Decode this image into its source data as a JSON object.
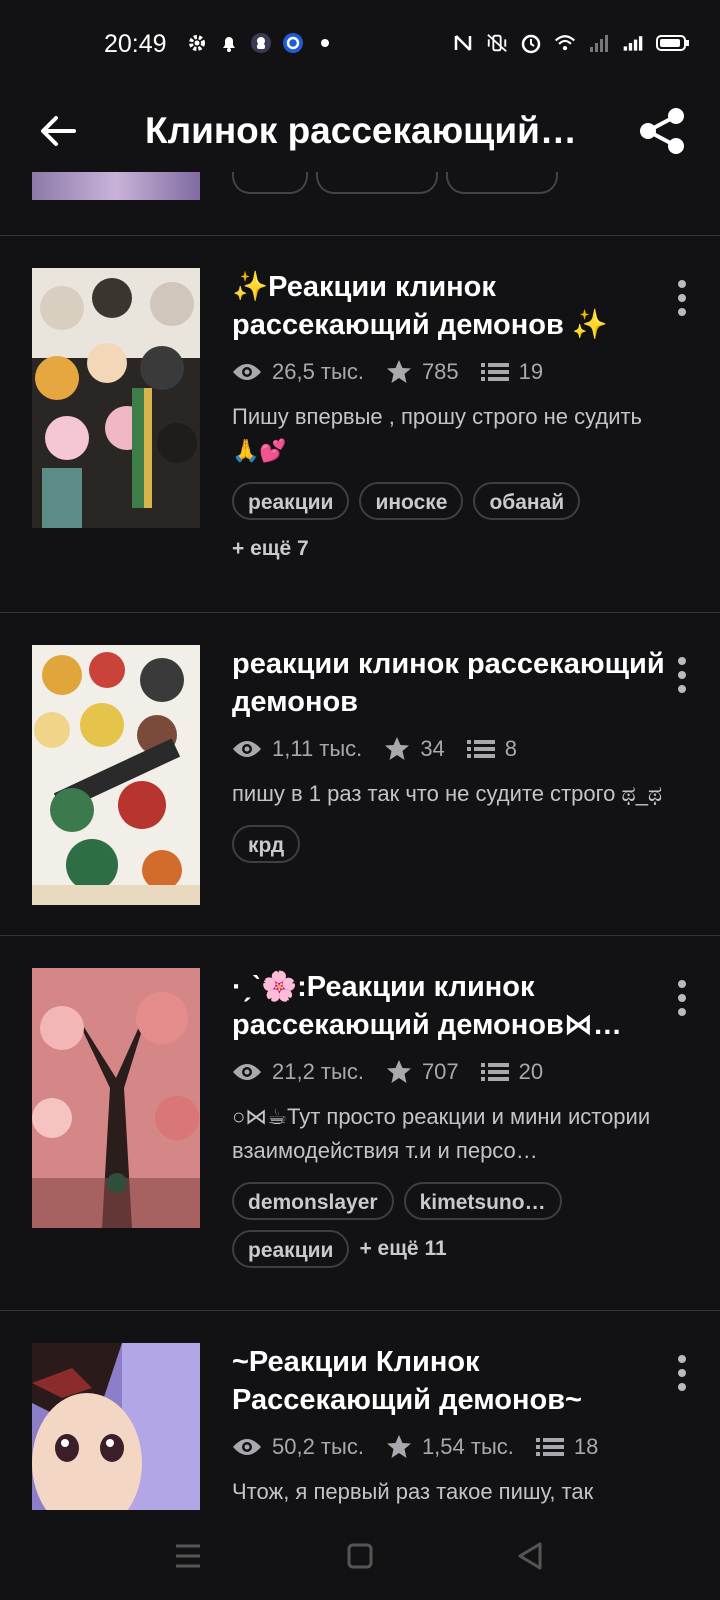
{
  "status_bar": {
    "time": "20:49",
    "left_icons": [
      "gear-icon",
      "bell-icon",
      "app-notification-icon",
      "sync-app-icon",
      "dot-icon"
    ],
    "right_icons": [
      "nfc-icon",
      "vibrate-icon",
      "alarm-icon",
      "wifi-icon",
      "signal-off-icon",
      "signal-icon",
      "battery-icon"
    ]
  },
  "header": {
    "title": "Клинок рассекающий…"
  },
  "colors": {
    "background": "#121214",
    "text_primary": "#ffffff",
    "text_secondary": "#a8a8ae",
    "divider": "#34343a",
    "tag_border": "#3e3e44"
  },
  "stories": [
    {
      "title": "✨Реакции клинок рассекающий демонов ✨",
      "views": "26,5 тыс.",
      "votes": "785",
      "chapters": "19",
      "description": "Пишу впервые , прошу строго не судить 🙏💕",
      "tags": [
        "реакции",
        "иноске",
        "обанай"
      ],
      "more": "+ ещё 7"
    },
    {
      "title": "реакции клинок рассекающий демонов",
      "views": "1,11 тыс.",
      "votes": "34",
      "chapters": "8",
      "description": "пишу в 1 раз так что не судите строго ಥ_ಥ",
      "tags": [
        "крд"
      ],
      "more": ""
    },
    {
      "title": "·ˏˋ🌸:Реакции клинок рассекающий демонов⋈…",
      "views": "21,2 тыс.",
      "votes": "707",
      "chapters": "20",
      "description": "○⋈☕Тут просто реакции и мини истории взаимодействия т.и и персо…",
      "tags": [
        "demonslayer",
        "kimetsuno…",
        "реакции"
      ],
      "more": "+ ещё 11"
    },
    {
      "title": "~Реакции Клинок Рассекающий демонов~",
      "views": "50,2 тыс.",
      "votes": "1,54 тыс.",
      "chapters": "18",
      "description": "Чтож, я первый раз такое пишу, так",
      "tags": [],
      "more": ""
    }
  ]
}
